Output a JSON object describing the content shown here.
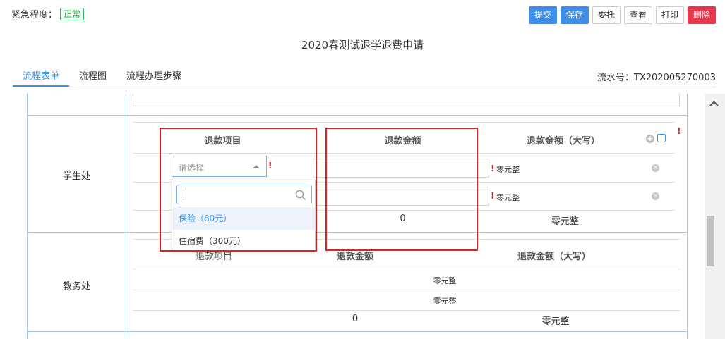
{
  "urgency": {
    "label": "紧急程度：",
    "value": "正常"
  },
  "toolbar": {
    "submit": "提交",
    "save": "保存",
    "delegate": "委托",
    "view": "查看",
    "print": "打印",
    "delete": "删除"
  },
  "page_title": "2020春测试退学退费申请",
  "tabs": [
    "流程表单",
    "流程图",
    "流程办理步骤"
  ],
  "serial": "流水号：TX202005270003",
  "sections": {
    "student": {
      "label": "学生处",
      "headers": [
        "退款项目",
        "退款金额",
        "退款金额（大写）"
      ],
      "rows": [
        {
          "amount_cn": "零元整"
        },
        {
          "amount_cn": "零元整"
        }
      ],
      "total": {
        "amount": "0",
        "amount_cn": "零元整"
      },
      "select_placeholder": "请选择",
      "required_mark": "!",
      "options": [
        "保险（80元）",
        "住宿费（300元）"
      ]
    },
    "academic": {
      "label": "教务处",
      "headers": [
        "退款项目",
        "退款金额",
        "退款金额（大写）"
      ],
      "rows": [
        {
          "amount_cn": "零元整"
        },
        {
          "amount_cn": "零元整"
        }
      ],
      "total": {
        "amount": "0",
        "amount_cn": "零元整"
      }
    }
  },
  "icons": {
    "add": "plus-circle-icon",
    "import": "import-icon",
    "remove": "remove-circle-icon",
    "search": "search-icon"
  },
  "colors": {
    "accent": "#3d8fe8",
    "danger": "#e8364a",
    "highlight_box": "#e02020",
    "grid": "#9cc9e6"
  }
}
